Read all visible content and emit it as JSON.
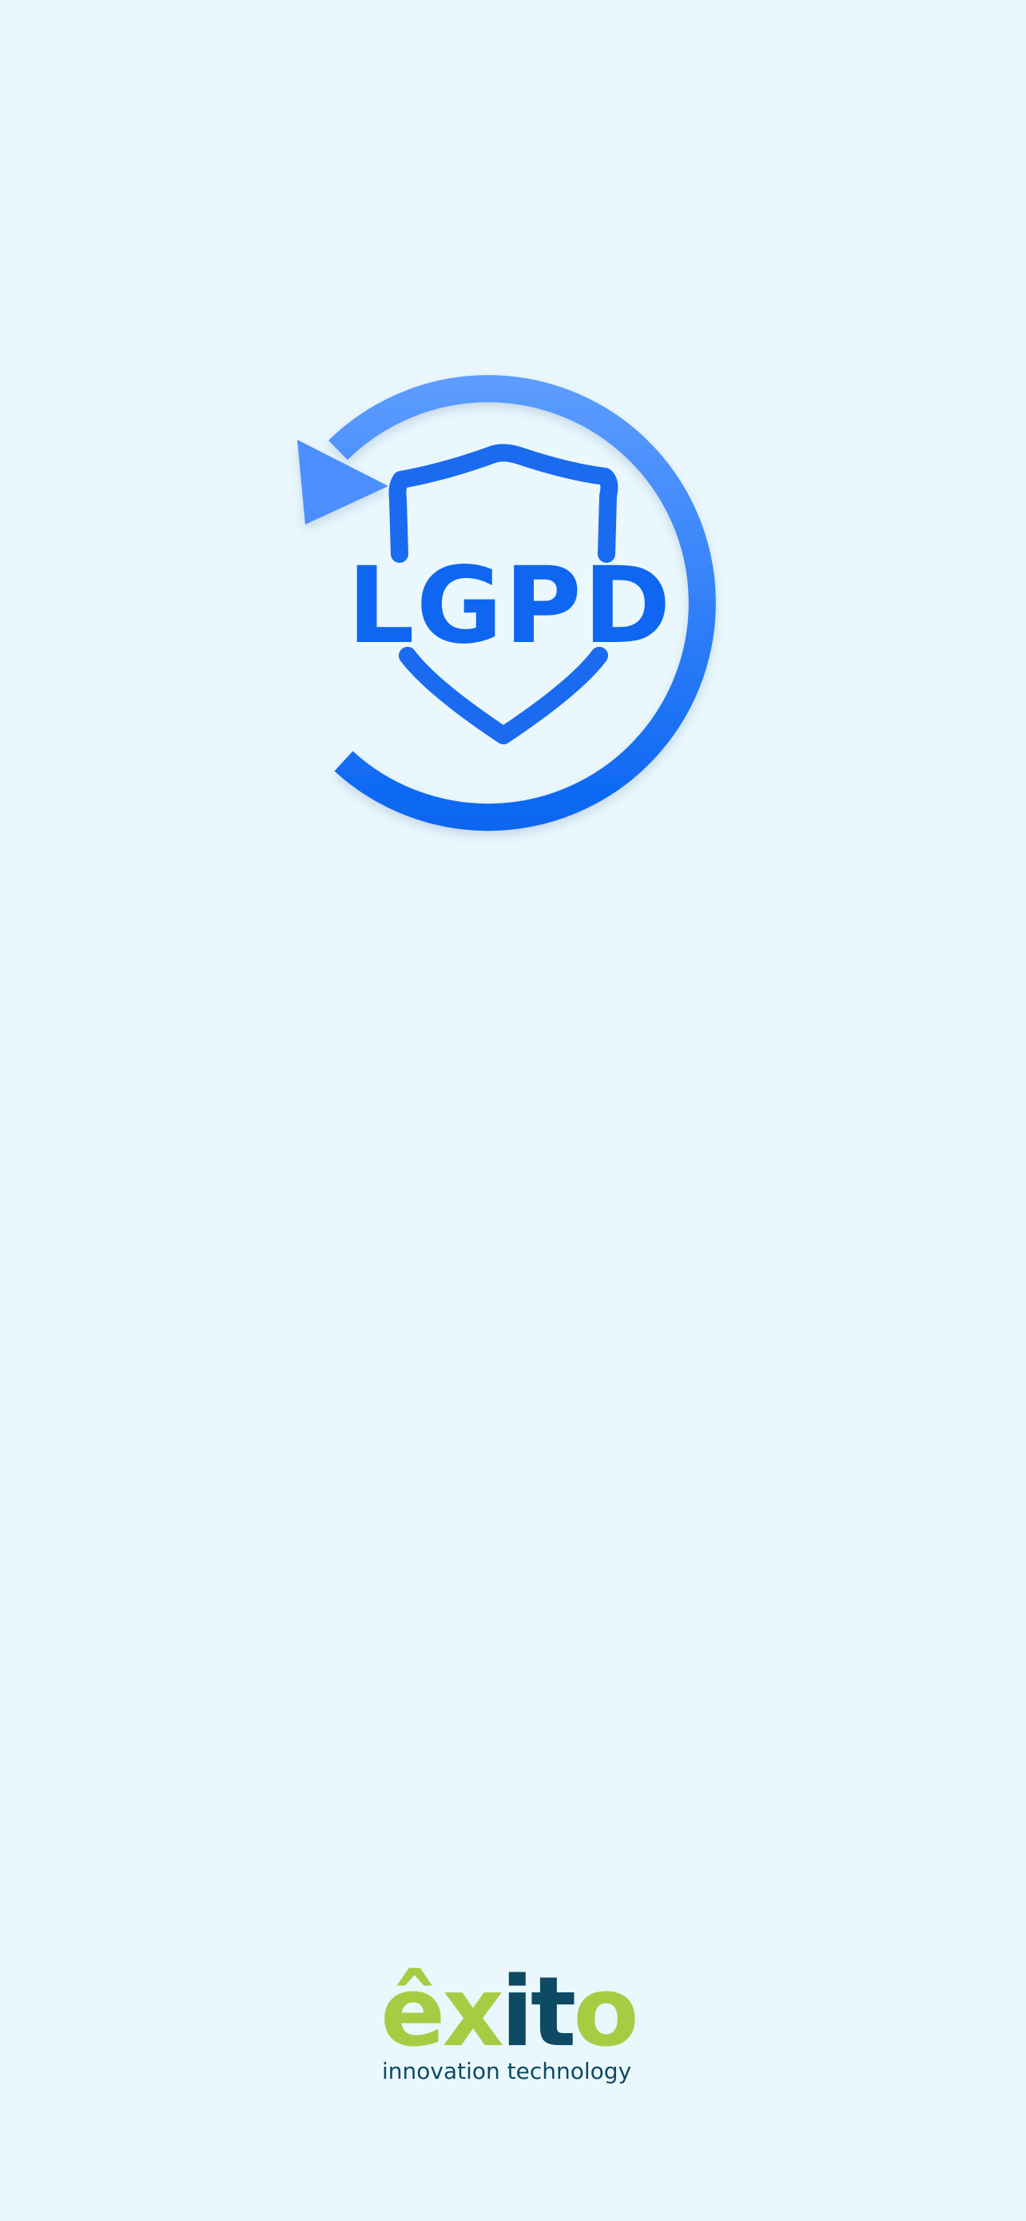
{
  "app": {
    "logo_text": "LGPD",
    "logo_icon": "refresh-shield-icon",
    "accent_color": "#1a73f2"
  },
  "brand": {
    "name_part1": "êx",
    "name_part2": "it",
    "name_part3": "o",
    "tagline": "innovation technology",
    "green": "#a6cc44",
    "navy": "#0e4a63"
  }
}
